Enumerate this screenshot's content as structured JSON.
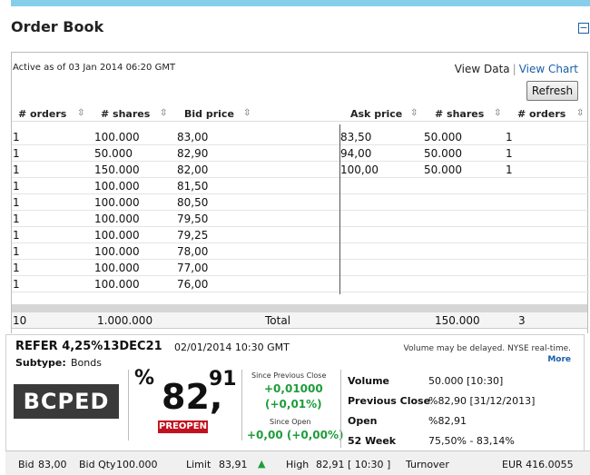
{
  "title": "Order Book",
  "active_as_of": "Active as of 03 Jan 2014 06:20 GMT",
  "view": {
    "data": "View Data",
    "separator": "|",
    "chart": "View Chart"
  },
  "refresh_label": "Refresh",
  "columns": {
    "bid_orders": "# orders",
    "bid_shares": "# shares",
    "bid_price": "Bid price",
    "ask_price": "Ask price",
    "ask_shares": "# shares",
    "ask_orders": "# orders"
  },
  "bids": [
    {
      "orders": "1",
      "shares": "100.000",
      "price": "83,00"
    },
    {
      "orders": "1",
      "shares": "50.000",
      "price": "82,90"
    },
    {
      "orders": "1",
      "shares": "150.000",
      "price": "82,00"
    },
    {
      "orders": "1",
      "shares": "100.000",
      "price": "81,50"
    },
    {
      "orders": "1",
      "shares": "100.000",
      "price": "80,50"
    },
    {
      "orders": "1",
      "shares": "100.000",
      "price": "79,50"
    },
    {
      "orders": "1",
      "shares": "100.000",
      "price": "79,25"
    },
    {
      "orders": "1",
      "shares": "100.000",
      "price": "78,00"
    },
    {
      "orders": "1",
      "shares": "100.000",
      "price": "77,00"
    },
    {
      "orders": "1",
      "shares": "100.000",
      "price": "76,00"
    }
  ],
  "asks": [
    {
      "price": "83,50",
      "shares": "50.000",
      "orders": "1"
    },
    {
      "price": "94,00",
      "shares": "50.000",
      "orders": "1"
    },
    {
      "price": "100,00",
      "shares": "50.000",
      "orders": "1"
    }
  ],
  "totals": {
    "bid_orders": "10",
    "bid_shares": "1.000.000",
    "label": "Total",
    "ask_shares": "150.000",
    "ask_orders": "3"
  },
  "quote": {
    "name": "REFER 4,25%13DEC21",
    "datetime": "02/01/2014 10:30 GMT",
    "delay_note": "Volume may be delayed. NYSE real-time.",
    "more": "More",
    "subtype_label": "Subtype:",
    "subtype": "Bonds",
    "ticker": "BCPED",
    "pct_symbol": "%",
    "price_int": "82,",
    "price_dec": "91",
    "status": "PREOPEN",
    "since_prev_close_label": "Since Previous Close",
    "since_prev_close_value": "+0,01000",
    "since_prev_close_pct": "(+0,01%)",
    "since_open_label": "Since Open",
    "since_open_value": "+0,00 (+0,00%)",
    "volume_label": "Volume",
    "volume": "50.000 [10:30]",
    "prev_close_label": "Previous Close",
    "prev_close": "%82,90 [31/12/2013]",
    "open_label": "Open",
    "open": "%82,91",
    "week52_label": "52 Week",
    "week52": "75,50% - 83,14%"
  },
  "bottom": {
    "bid_label": "Bid",
    "bid": "83,00",
    "bid_qty_label": "Bid Qty",
    "bid_qty": "100.000",
    "limit_label": "Limit",
    "limit": "83,91",
    "high_label": "High",
    "high": "82,91 [ 10:30 ]",
    "turnover_label": "Turnover",
    "turnover": "EUR 416.0055"
  },
  "colors": {
    "accent": "#1a5ea8",
    "top_bar": "#87ceeb",
    "positive": "#1e9d3c",
    "status_red": "#c1121f",
    "ticker_bg": "#3a3a3a"
  }
}
